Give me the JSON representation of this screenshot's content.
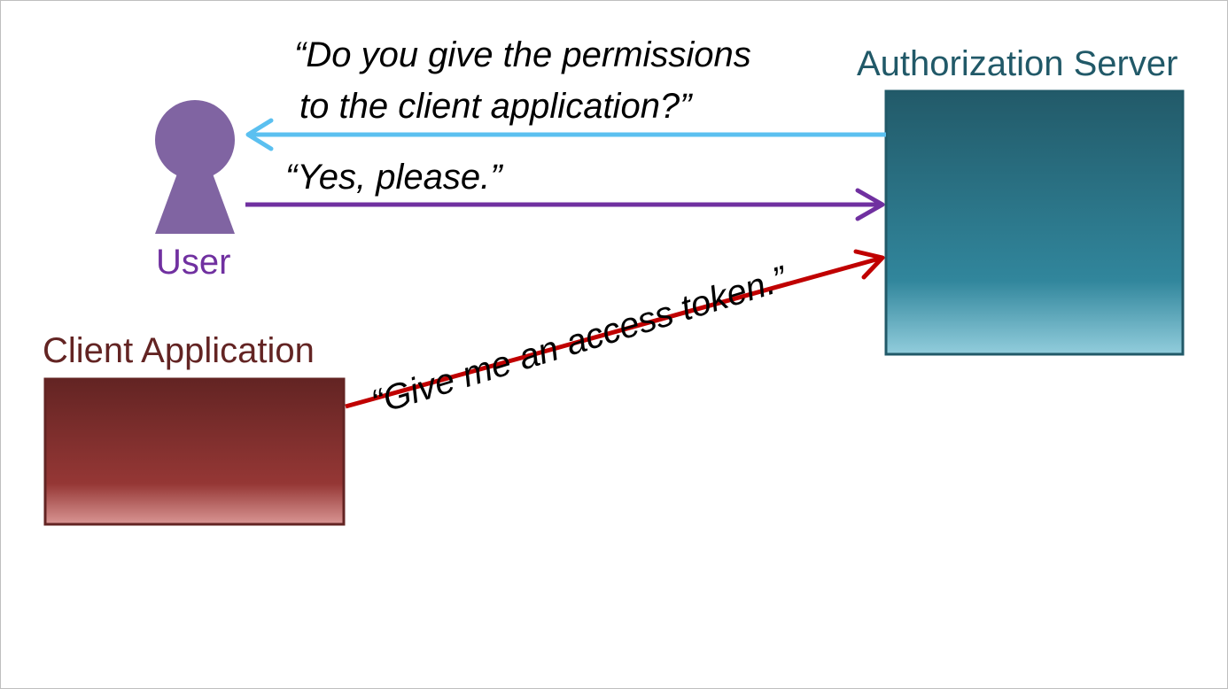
{
  "colors": {
    "user": "#8064a2",
    "user_text": "#7030a0",
    "client": "#632423",
    "client_light": "#d99694",
    "auth": "#215968",
    "auth_light": "#92cddc",
    "arrow_to_user": "#5bc0f0",
    "arrow_to_auth": "#7030a0",
    "arrow_token": "#c00000"
  },
  "nodes": {
    "auth_server": {
      "label": "Authorization Server",
      "icon": "server-box"
    },
    "user": {
      "label": "User",
      "icon": "keyhole-person-icon"
    },
    "client_app": {
      "label": "Client Application",
      "icon": "client-box"
    }
  },
  "messages": {
    "consent_question_line1": "“Do you give the permissions",
    "consent_question_line2": "to the client application?”",
    "consent_answer": "“Yes, please.”",
    "token_request": "“Give me an access token.”"
  }
}
